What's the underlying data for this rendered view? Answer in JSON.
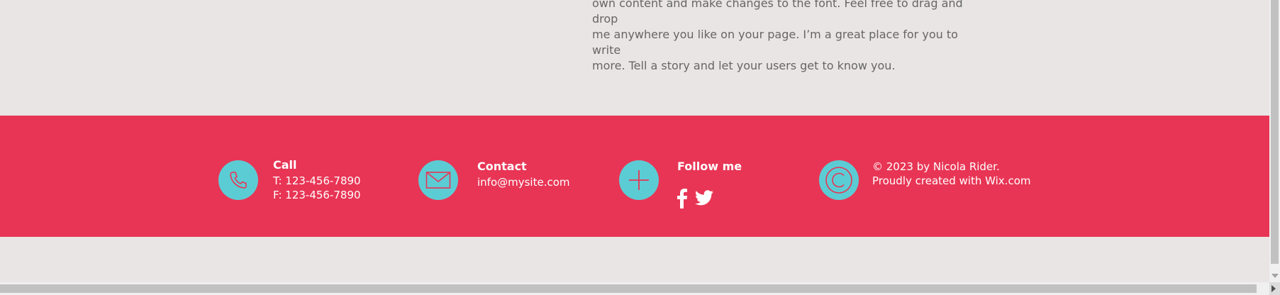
{
  "content": {
    "paragraph_lines": [
      "own content and make changes to the font. Feel free to drag and drop",
      "me anywhere you like on your page. I’m a great place for you to write",
      "more. Tell a story and let your users get to know you."
    ]
  },
  "footer": {
    "background_color": "#e83555",
    "icon_circle_color": "#5cccd4",
    "call": {
      "icon": "phone-icon",
      "title": "Call",
      "tel": "T: 123-456-7890",
      "fax": "F: 123-456-7890"
    },
    "contact": {
      "icon": "envelope-icon",
      "title": "Contact",
      "email": "info@mysite.com"
    },
    "follow": {
      "icon": "plus-icon",
      "title": "Follow me",
      "social": [
        "facebook-icon",
        "twitter-icon"
      ]
    },
    "copyright": {
      "icon": "copyright-icon",
      "line1": "© 2023 by Nicola Rider.",
      "line2": "Proudly created with Wix.com"
    }
  }
}
